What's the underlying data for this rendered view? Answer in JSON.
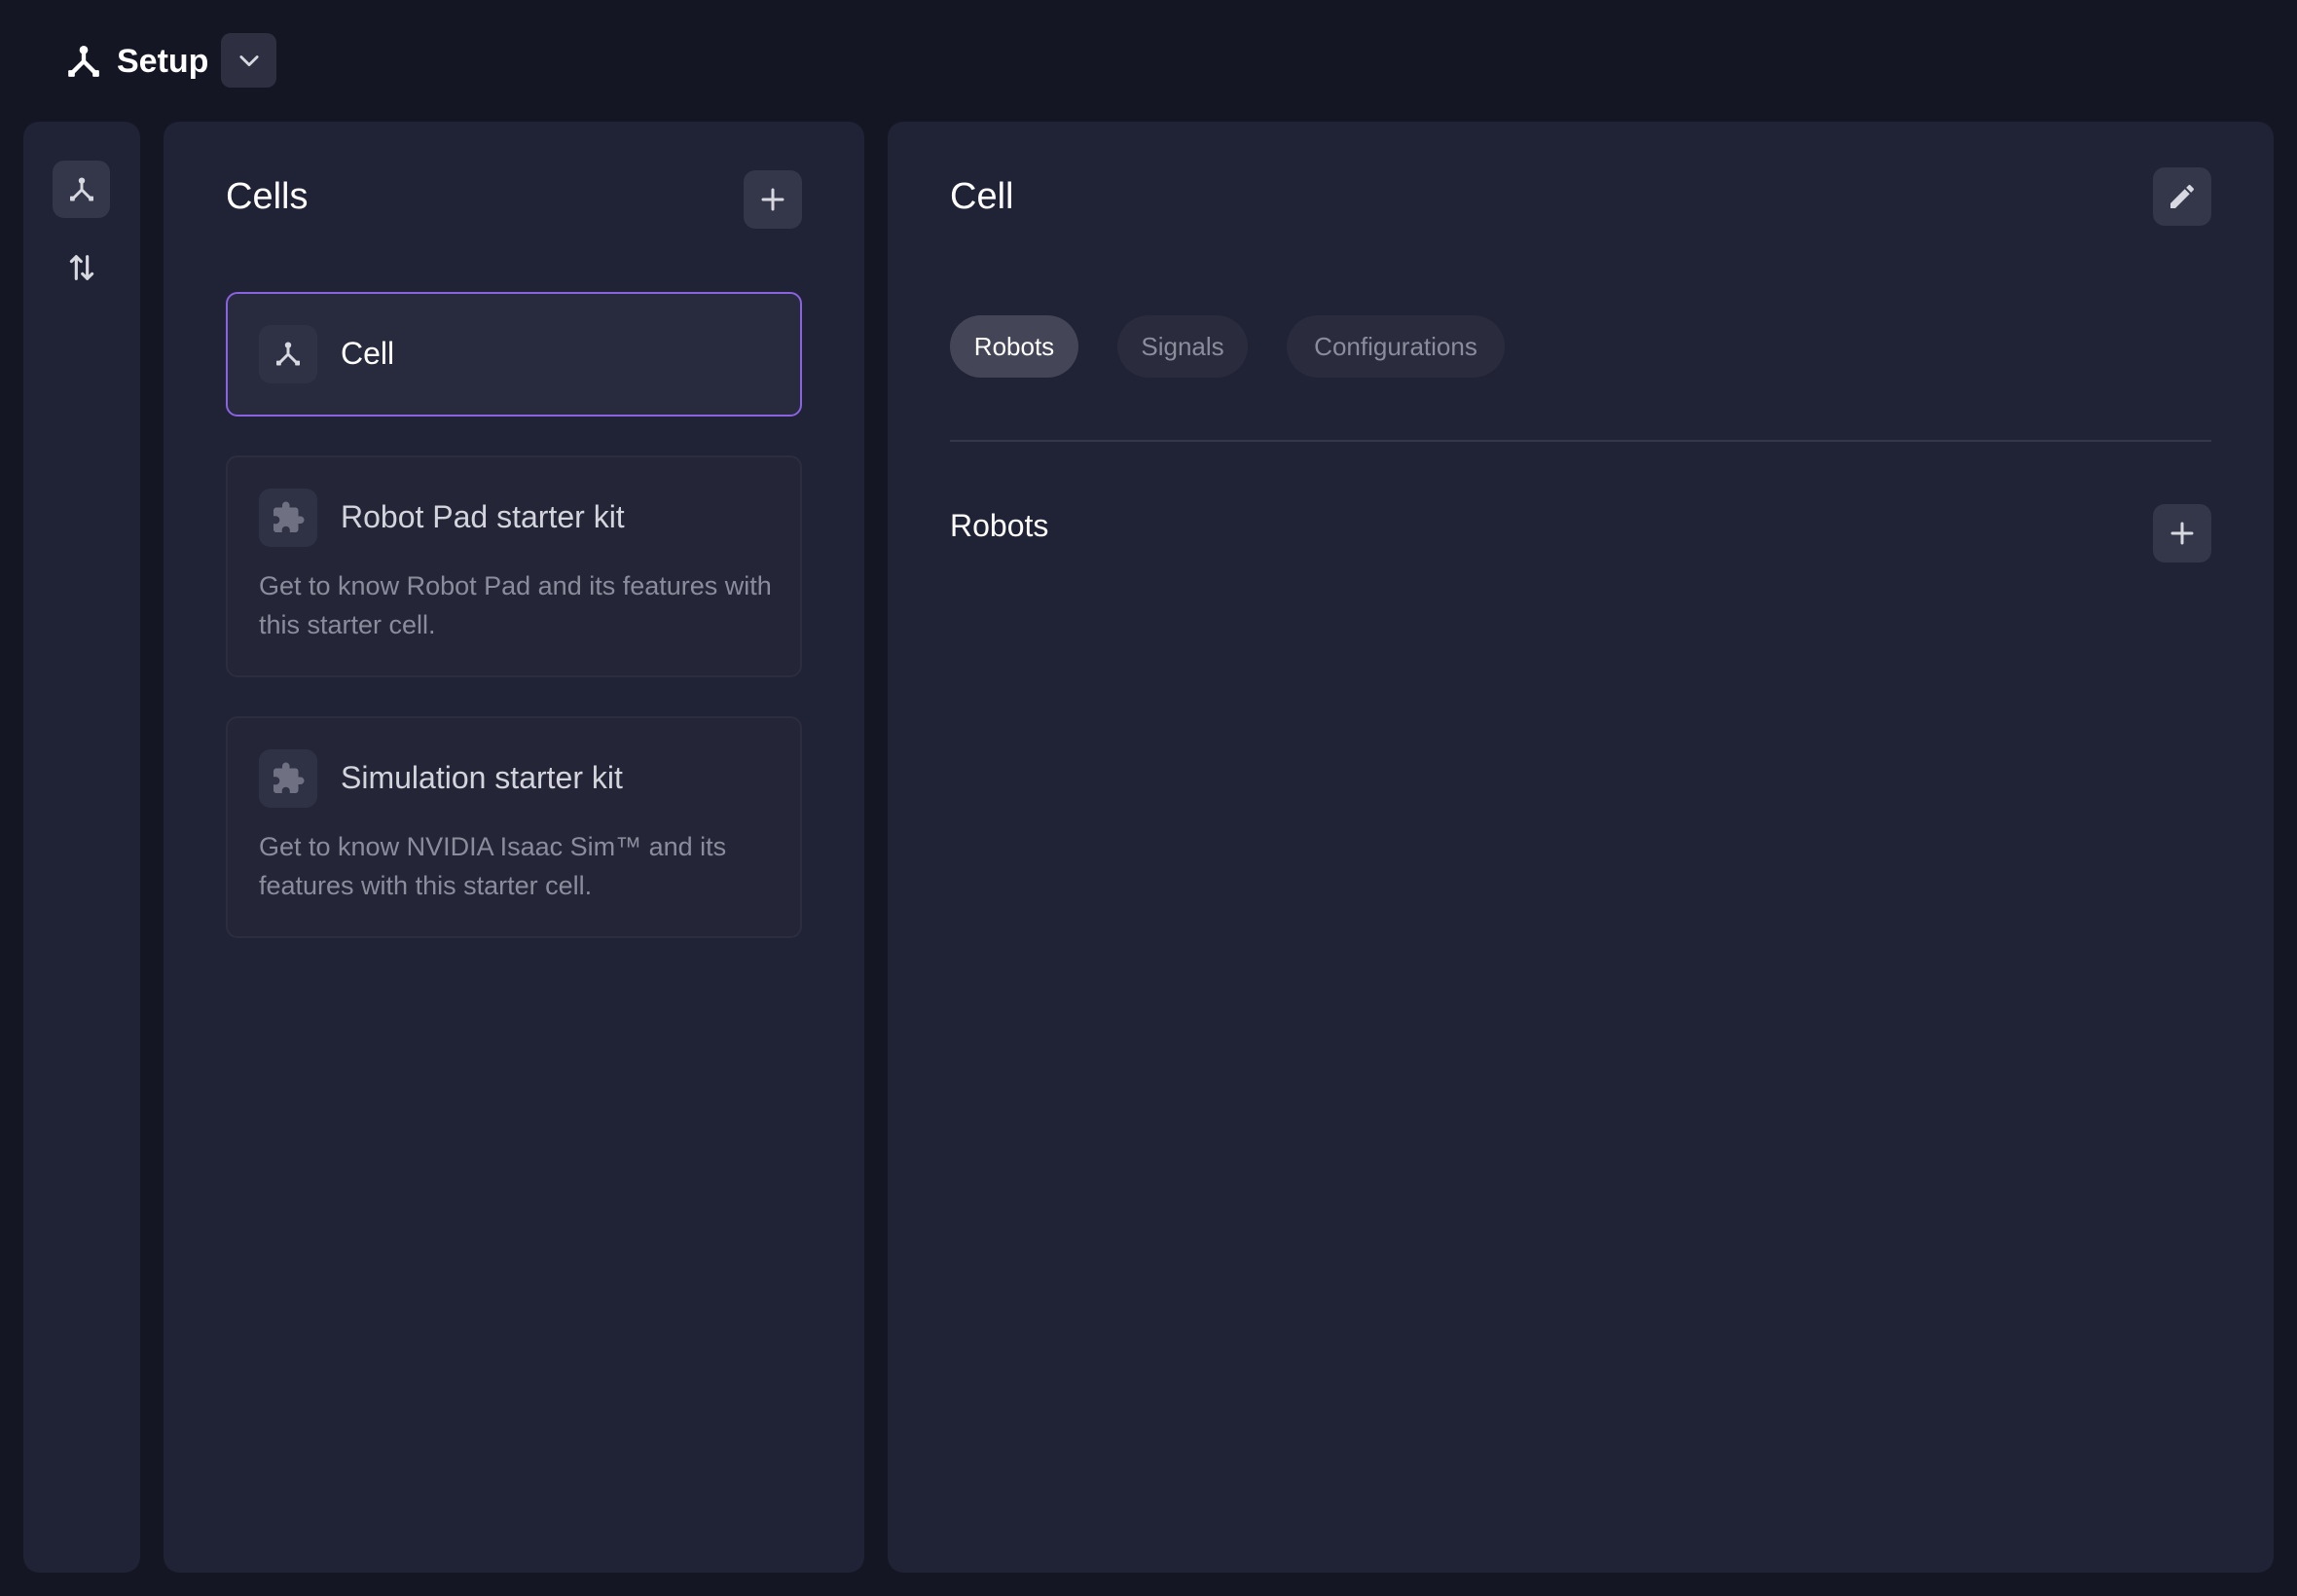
{
  "header": {
    "app_title": "Setup",
    "app_icon": "cell-network-icon",
    "dropdown_icon": "chevron-down-icon"
  },
  "rail": {
    "items": [
      {
        "icon": "cell-network-icon",
        "active": true
      },
      {
        "icon": "transfer-arrows-icon",
        "active": false
      }
    ]
  },
  "cells_panel": {
    "title": "Cells",
    "add_icon": "plus-icon",
    "cards": [
      {
        "title": "Cell",
        "icon": "cell-network-icon",
        "selected": true,
        "description": ""
      },
      {
        "title": "Robot Pad starter kit",
        "icon": "puzzle-piece-icon",
        "selected": false,
        "description": "Get to know Robot Pad and its features with this starter cell."
      },
      {
        "title": "Simulation starter kit",
        "icon": "puzzle-piece-icon",
        "selected": false,
        "description": "Get to know NVIDIA Isaac Sim™ and its features with this starter cell."
      }
    ]
  },
  "detail_panel": {
    "title": "Cell",
    "edit_icon": "pencil-icon",
    "tabs": [
      {
        "label": "Robots",
        "active": true
      },
      {
        "label": "Signals",
        "active": false
      },
      {
        "label": "Configurations",
        "active": false
      }
    ],
    "section_title": "Robots",
    "section_add_icon": "plus-icon"
  },
  "colors": {
    "background": "#141624",
    "panel": "#202235",
    "accent": "#8a63e0",
    "muted_text": "#8b8d9d"
  }
}
